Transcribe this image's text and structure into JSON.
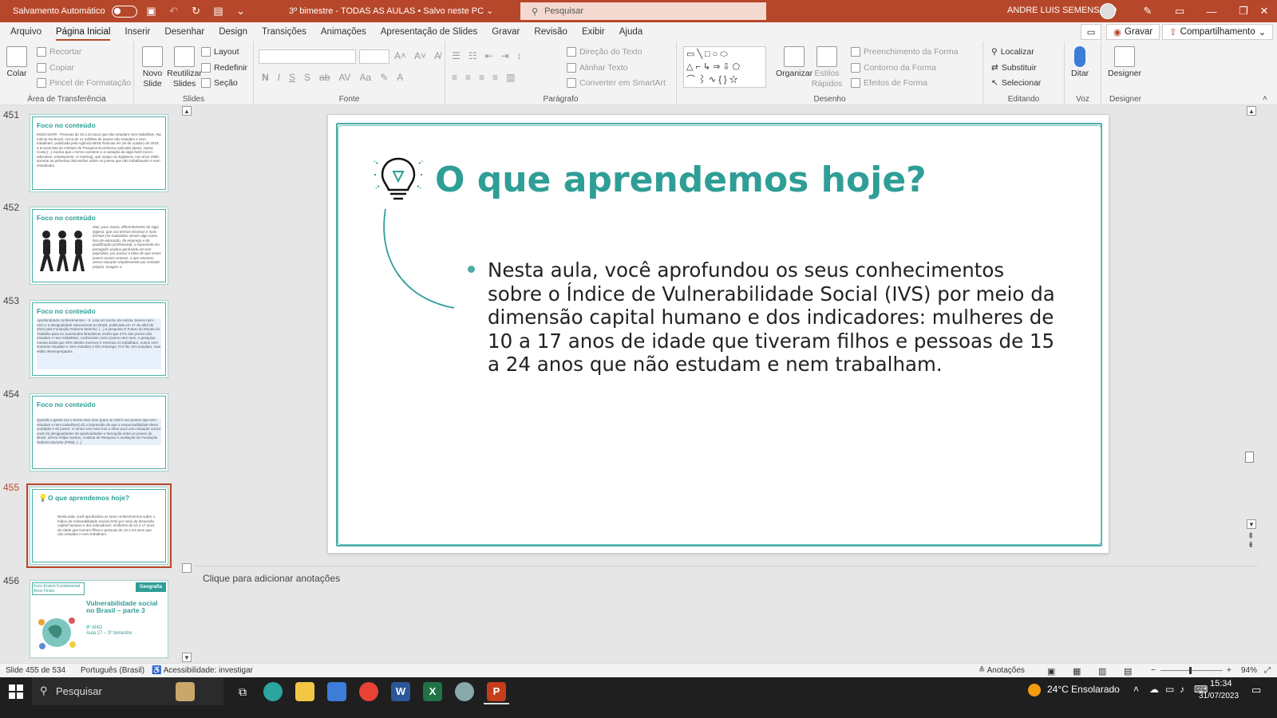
{
  "titlebar": {
    "autosave_label": "Salvamento Automático",
    "doc_title": "3º bimestre - TODAS AS AULAS • Salvo neste PC ⌄",
    "search_placeholder": "Pesquisar",
    "user_name": "ANDRE LUIS SEMENSATO"
  },
  "menu": {
    "items": [
      "Arquivo",
      "Página Inicial",
      "Inserir",
      "Desenhar",
      "Design",
      "Transições",
      "Animações",
      "Apresentação de Slides",
      "Gravar",
      "Revisão",
      "Exibir",
      "Ajuda"
    ],
    "record": "Gravar",
    "share": "Compartilhamento"
  },
  "ribbon": {
    "clipboard": {
      "paste": "Colar",
      "cut": "Recortar",
      "copy": "Copiar",
      "painter": "Pincel de Formatação",
      "label": "Área de Transferência"
    },
    "slides": {
      "new": "Novo Slide",
      "reuse": "Reutilizar Slides",
      "layout": "Layout",
      "reset": "Redefinir",
      "section": "Seção",
      "label": "Slides"
    },
    "font": {
      "label": "Fonte"
    },
    "paragraph": {
      "text_dir": "Direção do Texto",
      "align_text": "Alinhar Texto",
      "smartart": "Converter em SmartArt",
      "label": "Parágrafo"
    },
    "drawing": {
      "arrange": "Organizar",
      "quick_styles": "Estilos Rápidos",
      "fill": "Preenchimento da Forma",
      "outline": "Contorno da Forma",
      "effects": "Efeitos de Forma",
      "label": "Desenho"
    },
    "editing": {
      "find": "Localizar",
      "replace": "Substituir",
      "select": "Selecionar",
      "label": "Editando"
    },
    "voice": {
      "dictate": "Ditar",
      "label": "Voz"
    },
    "designer": {
      "btn": "Designer",
      "label": "Designer"
    }
  },
  "thumbnails": [
    {
      "num": "451",
      "title": "Foco no conteúdo",
      "text": "INDICADOR - Pessoas de 15 a 24 anos que não estudam nem trabalham. Na notícia No Brasil, cerca de 11 milhões de jovens não estudam e nem trabalham, publicada pela Agência IBGE Notícias em 29 de outubro de 2019, a economista do Instituto de Pesquisa Econômica Aplicada (Ipea), Joana Costa [...] explica que o termo nomeem e a variação da sigla Neet (not in education, employment, or training), que surgiu na Inglaterra, nos anos 1990, durante as primeiras discussões sobre os jovens que não trabalhavam e nem estudavam."
    },
    {
      "num": "452",
      "title": "Foco no conteúdo",
      "text": "Mas, para Joana, diferentemente da sigla inglesa, que usa termos técnicos e mais formais (se traduzidos seriam algo como fora de educação, do emprego e da qualificação profissional), a expressão em português acabou ganhando um tom pejorativo, por passar a ideia de que esses jovens seriam ociosos, o que estariam nessa situação simplesmente por vontade própria. Imagem 4"
    },
    {
      "num": "453",
      "title": "Foco no conteúdo",
      "text": "Aprofundando conhecimentos – II. Leia um trecho da notícia Jovens nem-nem e a desigualdade educacional no Brasil, publicada em 17 de abril de 2023 pela Fundação Roberto Marinho. [...] a pesquisa O Futuro do Mundo do Trabalho para as Juventudes Brasileiras revela que 27% dos jovens não estudam e nem trabalham, conhecidos como jovens nem-nem. A pesquisa mostra ainda que 36% destes meninos e meninas só trabalham, outros 15% somente estudam e 16% estudam e têm emprego. Por fim, 5% estudam, mas estão desempregados."
    },
    {
      "num": "454",
      "title": "Foco no conteúdo",
      "text": "Quando a gente usa o termo nem-nem (para se referir aos jovens que nem estudam e nem trabalham) dá a impressão de que a responsabilidade desta condição é do jovem. O termo sem-sem traz o olhar para uma situação social, onde há desigualdades de oportunidades e formação entre os jovens do Brasil, afirma Felipe Santos, Analista de Pesquisa e Avaliação da Fundação Roberto Marinho (FRM). [...]"
    },
    {
      "num": "455",
      "title": "O que aprendemos hoje?",
      "text": "Nesta aula, você aprofundou os seus conhecimentos sobre o Índice de Vulnerabilidade Social (IVS) por meio da dimensão capital humano e dos indicadores: mulheres de 10 a 17 anos de idade que tiveram filhos e pessoas de 15 a 24 anos que não estudam e nem trabalham."
    },
    {
      "num": "456",
      "title": "Vulnerabilidade social no Brasil – parte 3",
      "tag": "Geografia",
      "top": "Foco Ensino Fundamental Anos Finais",
      "sub1": "8º ANO",
      "sub2": "Aula 27 – 3º bimestre"
    }
  ],
  "slide": {
    "title": "O que aprendemos hoje?",
    "body": "Nesta aula, você aprofundou os seus conhecimentos sobre o Índice de Vulnerabilidade Social (IVS) por meio da dimensão capital humano e dos indicadores: mulheres de 10 a 17 anos de idade que tiveram filhos e pessoas de 15 a 24 anos que não estudam e nem trabalham."
  },
  "notes_placeholder": "Clique para adicionar anotações",
  "status": {
    "slide_count": "Slide 455 de 534",
    "language": "Português (Brasil)",
    "accessibility": "Acessibilidade: investigar",
    "notes": "Anotações",
    "zoom": "94%"
  },
  "taskbar": {
    "search": "Pesquisar",
    "weather": "24°C  Ensolarado",
    "time": "15:34",
    "date": "31/07/2023"
  },
  "colors": {
    "accent": "#b7472a",
    "teal": "#2e9e96"
  }
}
